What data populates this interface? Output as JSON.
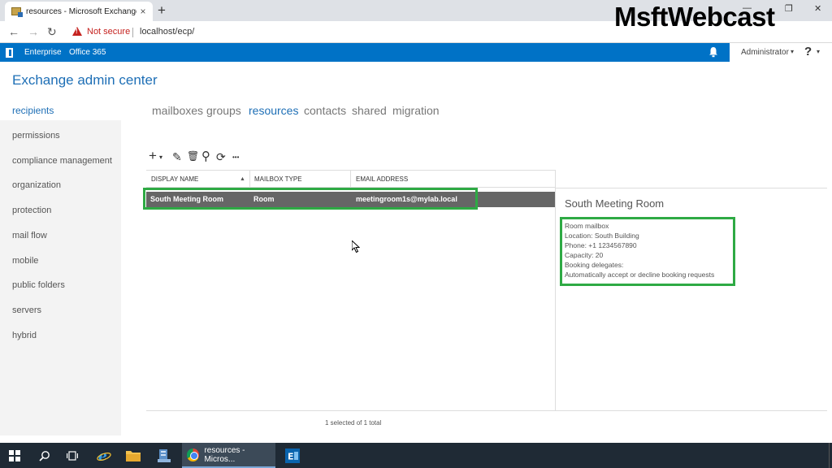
{
  "browser": {
    "tab_title": "resources - Microsoft Exchange",
    "tab_close": "×",
    "new_tab": "+",
    "win_min": "—",
    "win_max": "❐",
    "win_close": "✕",
    "back": "←",
    "forward": "→",
    "reload": "↻",
    "not_secure": "Not secure",
    "url": "localhost/ecp/"
  },
  "watermark": "MsftWebcast",
  "o365": {
    "enterprise": "Enterprise",
    "office365": "Office 365",
    "user": "Administrator",
    "user_caret": "▾",
    "help": "?",
    "help_caret": "▾"
  },
  "eac_title": "Exchange admin center",
  "leftnav": {
    "items": [
      {
        "label": "recipients"
      },
      {
        "label": "permissions"
      },
      {
        "label": "compliance management"
      },
      {
        "label": "organization"
      },
      {
        "label": "protection"
      },
      {
        "label": "mail flow"
      },
      {
        "label": "mobile"
      },
      {
        "label": "public folders"
      },
      {
        "label": "servers"
      },
      {
        "label": "hybrid"
      }
    ]
  },
  "tabs": [
    {
      "label": "mailboxes"
    },
    {
      "label": "groups"
    },
    {
      "label": "resources"
    },
    {
      "label": "contacts"
    },
    {
      "label": "shared"
    },
    {
      "label": "migration"
    }
  ],
  "toolbar": {
    "add": "+",
    "add_caret": "▾",
    "edit": "✎",
    "delete": "🗑",
    "search": "⚲",
    "refresh": "⟳",
    "more": "•••"
  },
  "grid": {
    "headers": {
      "display_name": "DISPLAY NAME",
      "mailbox_type": "MAILBOX TYPE",
      "email_address": "EMAIL ADDRESS"
    },
    "sort_indicator": "▲",
    "rows": [
      {
        "display_name": "South Meeting Room",
        "mailbox_type": "Room",
        "email_address": "meetingroom1s@mylab.local"
      }
    ],
    "status": "1 selected of 1 total"
  },
  "detail": {
    "title": "South Meeting Room",
    "lines": [
      "Room mailbox",
      "Location: South Building",
      "Phone: +1 1234567890",
      "Capacity: 20",
      "Booking delegates:",
      "Automatically accept or decline booking requests"
    ]
  },
  "taskbar": {
    "chrome_label": "resources - Micros..."
  },
  "colors": {
    "o365_blue": "#0072c6",
    "eac_blue": "#1e6fb6",
    "highlight_green": "#2eaa44",
    "selected_row": "#666666"
  }
}
